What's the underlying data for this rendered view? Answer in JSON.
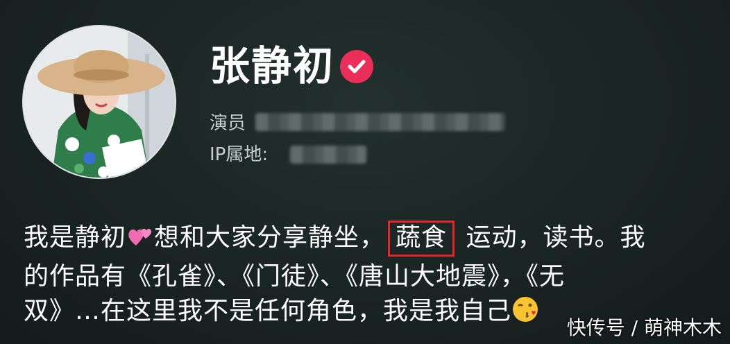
{
  "profile": {
    "name": "张静初",
    "occupation_label": "演员",
    "ip_label": "IP属地:",
    "verified_icon": "verified-badge-icon"
  },
  "bio": {
    "part1": "我是静初",
    "part2": "想和大家分享静坐，",
    "highlight": "蔬食",
    "part3": "运动，读书。我",
    "line2": "的作品有《孔雀》、《门徒》、《唐山大地震》，《无",
    "line3": "双》…在这里我不是任何角色，我是我自己"
  },
  "watermark": "快传号 / 萌神木木",
  "colors": {
    "background": "#1a2423",
    "verified": "#ea2e5a",
    "highlight_border": "#e3262d"
  }
}
